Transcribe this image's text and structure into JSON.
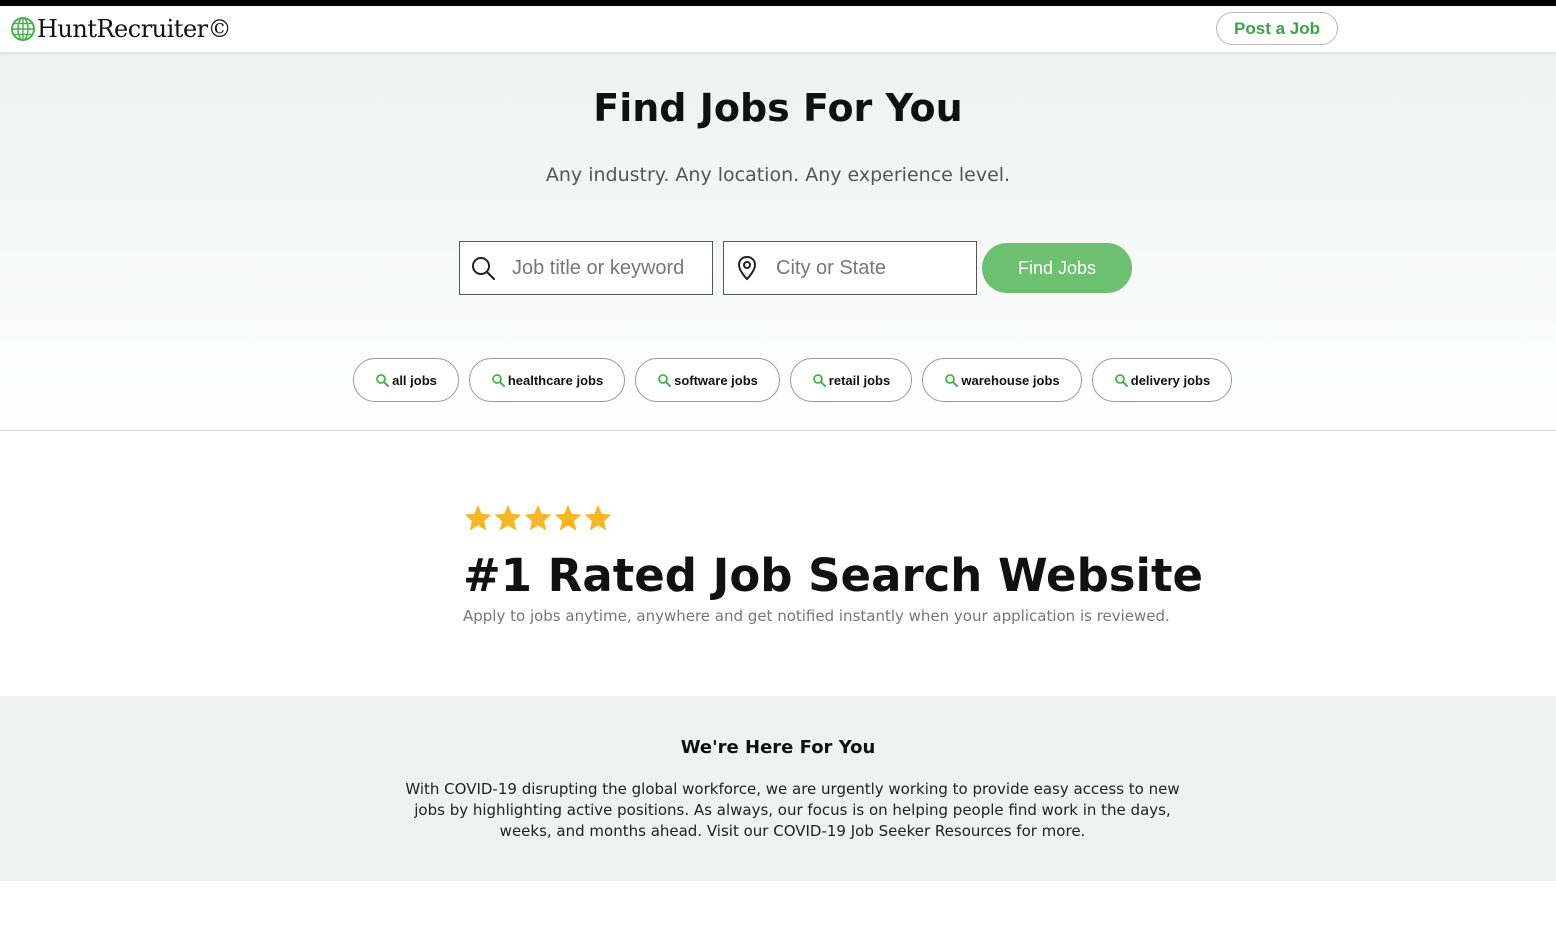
{
  "header": {
    "logo_text": "HuntRecruiter©",
    "logo_icon": "globe-icon",
    "post_job_label": "Post a Job"
  },
  "hero": {
    "title": "Find Jobs For You",
    "subtitle": "Any industry. Any location. Any experience level.",
    "keyword_placeholder": "Job title or keyword",
    "location_placeholder": "City or State",
    "find_button_label": "Find Jobs",
    "chips": [
      "all jobs",
      "healthcare jobs",
      "software jobs",
      "retail jobs",
      "warehouse jobs",
      "delivery jobs"
    ]
  },
  "rated": {
    "stars": 5,
    "title": "#1 Rated Job Search Website",
    "subtitle": "Apply to jobs anytime, anywhere and get notified instantly when your application is reviewed."
  },
  "here": {
    "title": "We're Here For You",
    "text": "With COVID-19 disrupting the global workforce, we are urgently working to provide easy access to new jobs by highlighting active positions. As always, our focus is on helping people find work in the days, weeks, and months ahead. Visit our COVID-19 Job Seeker Resources for more."
  },
  "colors": {
    "accent_green": "#3aa54a",
    "button_green": "#6cc070",
    "star_gold": "#f6b626"
  }
}
